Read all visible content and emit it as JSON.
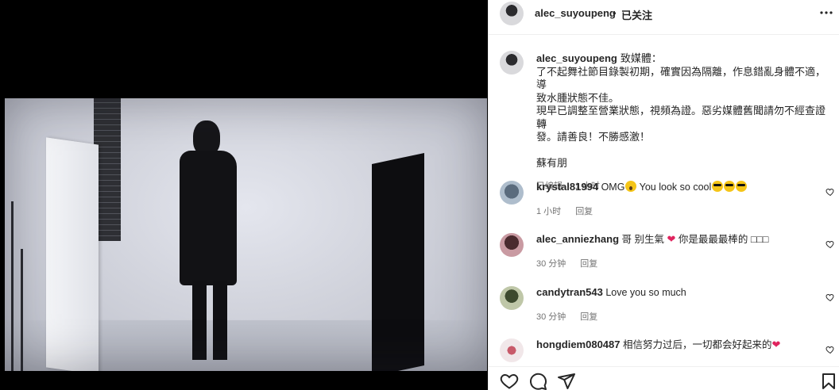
{
  "post": {
    "username": "alec_suyoupeng",
    "dot": "•",
    "follow_label": "已关注",
    "more_icon": "more-horizontal-icon"
  },
  "caption": {
    "username": "alec_suyoupeng",
    "lines": [
      "致媒體：",
      "了不起舞社節目錄製初期，確實因為隔離，作息錯亂身體不適，導",
      "致水腫狀態不佳。",
      "現早已調整至營業狀態，視頻為證。惡劣媒體舊聞請勿不經查證轉",
      "發。請善良！不勝感激！",
      "",
      "蘇有朋"
    ],
    "edited": "已编辑",
    "separator": "·",
    "time": "1 小时"
  },
  "comments": [
    {
      "username": "krystal81994",
      "text": "OMG",
      "text_after": " You look so cool",
      "time": "1 小时",
      "reply": "回复"
    },
    {
      "username": "alec_anniezhang",
      "text": "哥 别生氣 ",
      "text_after": " 你是最最最棒的 □□□",
      "time": "30 分钟",
      "reply": "回复"
    },
    {
      "username": "candytran543",
      "text": "Love you so much",
      "time": "30 分钟",
      "reply": "回复"
    },
    {
      "username": "hongdiem080487",
      "text": "相信努力过后，一切都会好起来的",
      "time": "",
      "reply": ""
    }
  ],
  "actions": {
    "like_icon": "heart-icon",
    "comment_icon": "comment-icon",
    "share_icon": "send-icon",
    "save_icon": "bookmark-icon"
  },
  "colors": {
    "text": "#262626",
    "secondary": "#737373",
    "border": "#efefef",
    "heart_red": "#e0245e"
  }
}
